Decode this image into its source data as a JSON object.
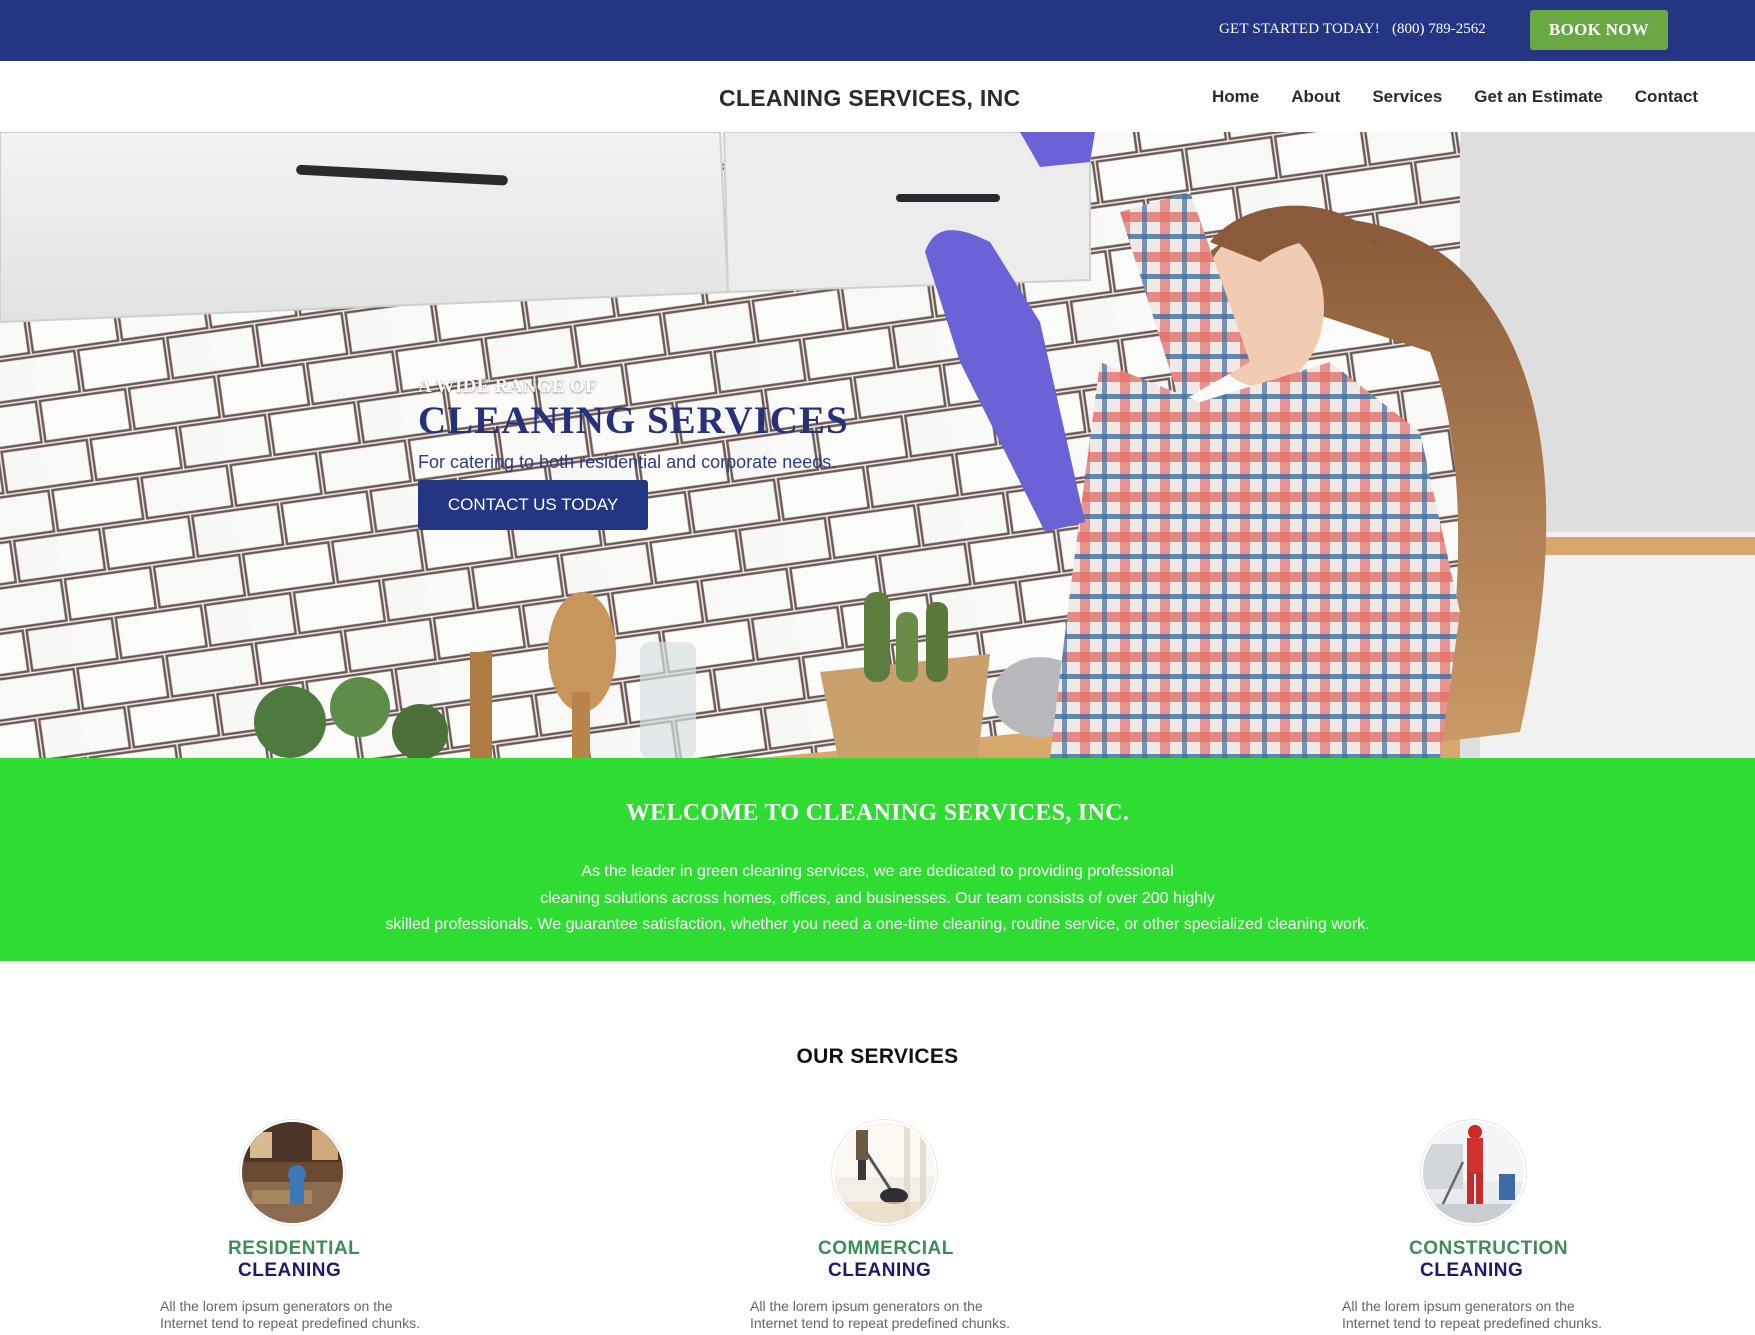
{
  "topbar": {
    "promo": "GET STARTED TODAY!",
    "phone": "(800) 789-2562",
    "book_label": "BOOK NOW"
  },
  "nav": {
    "brand": "CLEANING SERVICES, INC",
    "links": [
      "Home",
      "About",
      "Services",
      "Get an Estimate",
      "Contact"
    ]
  },
  "hero": {
    "kicker": "A WIDE RANGE OF",
    "headline": "CLEANING SERVICES",
    "subline": "For catering to both residential and corporate needs.",
    "cta_label": "CONTACT US TODAY"
  },
  "welcome": {
    "title": "WELCOME TO CLEANING SERVICES, INC.",
    "lines": [
      "As the leader in green cleaning services, we are dedicated to providing professional",
      "cleaning solutions across homes, offices, and businesses. Our team consists of over 200 highly",
      "skilled professionals. We guarantee satisfaction, whether you need a one-time cleaning, routine service, or other specialized cleaning work."
    ]
  },
  "services": {
    "title": "OUR SERVICES",
    "items": [
      {
        "name_line1": "RESIDENTIAL",
        "name_line2": "CLEANING",
        "desc_line1": "All the lorem ipsum generators on the",
        "desc_line2": "Internet tend to repeat predefined chunks."
      },
      {
        "name_line1": "COMMERCIAL",
        "name_line2": "CLEANING",
        "desc_line1": "All the lorem ipsum generators on the",
        "desc_line2": "Internet tend to repeat predefined chunks."
      },
      {
        "name_line1": "CONSTRUCTION",
        "name_line2": "CLEANING",
        "desc_line1": "All the lorem ipsum generators on the",
        "desc_line2": "Internet tend to repeat predefined chunks."
      }
    ]
  },
  "colors": {
    "topbar": "#233583",
    "book_button": "#6aa843",
    "welcome_band": "#2edc32",
    "headline": "#27317a",
    "service_green": "#3d8c5a",
    "service_navy": "#1e1a6b"
  }
}
